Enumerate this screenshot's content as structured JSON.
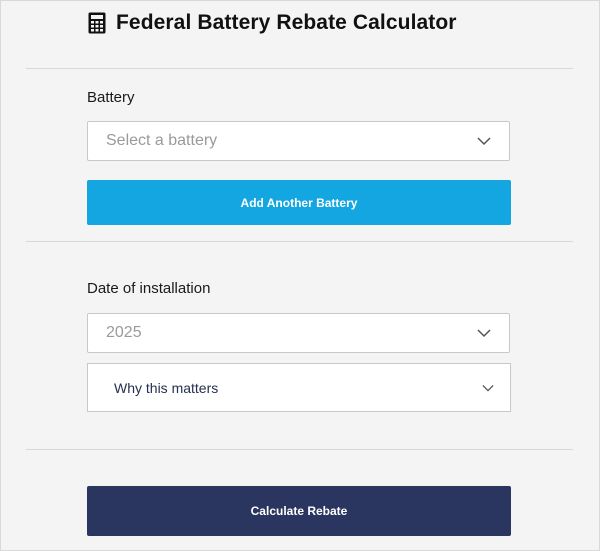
{
  "header": {
    "title": "Federal Battery Rebate Calculator",
    "icon": "calculator-icon"
  },
  "battery_section": {
    "label": "Battery",
    "select": {
      "placeholder": "Select a battery",
      "value": ""
    },
    "add_button_label": "Add Another Battery"
  },
  "installation_section": {
    "label": "Date of installation",
    "select": {
      "value": "2025"
    },
    "accordion_label": "Why this matters"
  },
  "actions": {
    "calculate_label": "Calculate Rebate"
  },
  "colors": {
    "add_button": "#14a6e0",
    "calculate_button": "#2a365f",
    "background": "#f4f4f4"
  }
}
